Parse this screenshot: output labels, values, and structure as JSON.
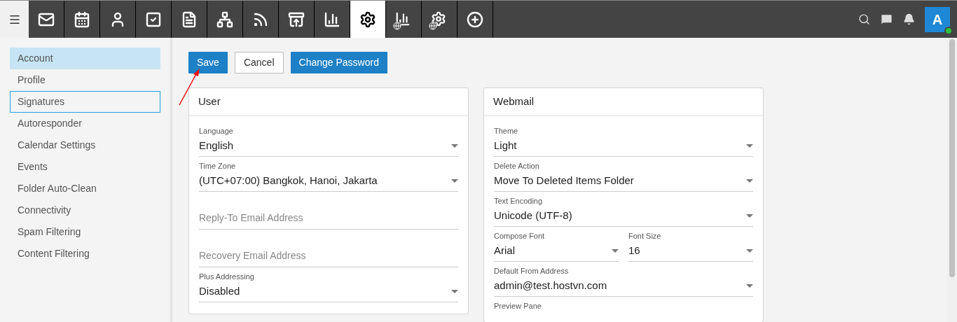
{
  "topbar": {
    "nav_items": [
      {
        "selected": false
      },
      {
        "selected": false
      },
      {
        "selected": false
      },
      {
        "selected": false
      },
      {
        "selected": false
      },
      {
        "selected": false
      },
      {
        "selected": false
      },
      {
        "selected": false
      },
      {
        "selected": false
      },
      {
        "selected": true
      },
      {
        "selected": false
      },
      {
        "selected": false
      },
      {
        "selected": false
      }
    ],
    "avatar": {
      "initial": "A",
      "online": true
    }
  },
  "sidebar": {
    "items": [
      {
        "label": "Account",
        "selected": true,
        "focused": false
      },
      {
        "label": "Profile",
        "selected": false,
        "focused": false
      },
      {
        "label": "Signatures",
        "selected": false,
        "focused": true
      },
      {
        "label": "Autoresponder",
        "selected": false,
        "focused": false
      },
      {
        "label": "Calendar Settings",
        "selected": false,
        "focused": false
      },
      {
        "label": "Events",
        "selected": false,
        "focused": false
      },
      {
        "label": "Folder Auto-Clean",
        "selected": false,
        "focused": false
      },
      {
        "label": "Connectivity",
        "selected": false,
        "focused": false
      },
      {
        "label": "Spam Filtering",
        "selected": false,
        "focused": false
      },
      {
        "label": "Content Filtering",
        "selected": false,
        "focused": false
      }
    ]
  },
  "actions": [
    {
      "label": "Save",
      "kind": "primary"
    },
    {
      "label": "Cancel",
      "kind": "secondary"
    },
    {
      "label": "Change Password",
      "kind": "primary"
    }
  ],
  "cards": [
    {
      "title": "User",
      "rows": [
        {
          "fields": [
            {
              "kind": "select",
              "label": "Language",
              "value": "English"
            }
          ]
        },
        {
          "fields": [
            {
              "kind": "select",
              "label": "Time Zone",
              "value": "(UTC+07:00) Bangkok, Hanoi, Jakarta"
            }
          ]
        },
        {
          "fields": [
            {
              "kind": "text",
              "placeholder": "Reply-To Email Address"
            }
          ]
        },
        {
          "fields": [
            {
              "kind": "text",
              "placeholder": "Recovery Email Address"
            }
          ]
        },
        {
          "fields": [
            {
              "kind": "select",
              "label": "Plus Addressing",
              "value": "Disabled"
            }
          ]
        }
      ]
    },
    {
      "title": "Webmail",
      "rows": [
        {
          "fields": [
            {
              "kind": "select",
              "label": "Theme",
              "value": "Light"
            }
          ]
        },
        {
          "fields": [
            {
              "kind": "select",
              "label": "Delete Action",
              "value": "Move To Deleted Items Folder"
            }
          ]
        },
        {
          "fields": [
            {
              "kind": "select",
              "label": "Text Encoding",
              "value": "Unicode (UTF-8)"
            }
          ]
        },
        {
          "fields": [
            {
              "kind": "select",
              "label": "Compose Font",
              "value": "Arial"
            },
            {
              "kind": "select",
              "label": "Font Size",
              "value": "16"
            }
          ]
        },
        {
          "fields": [
            {
              "kind": "select",
              "label": "Default From Address",
              "value": "admin@test.hostvn.com"
            }
          ]
        },
        {
          "fields": [
            {
              "kind": "label",
              "label": "Preview Pane"
            }
          ]
        }
      ]
    }
  ]
}
